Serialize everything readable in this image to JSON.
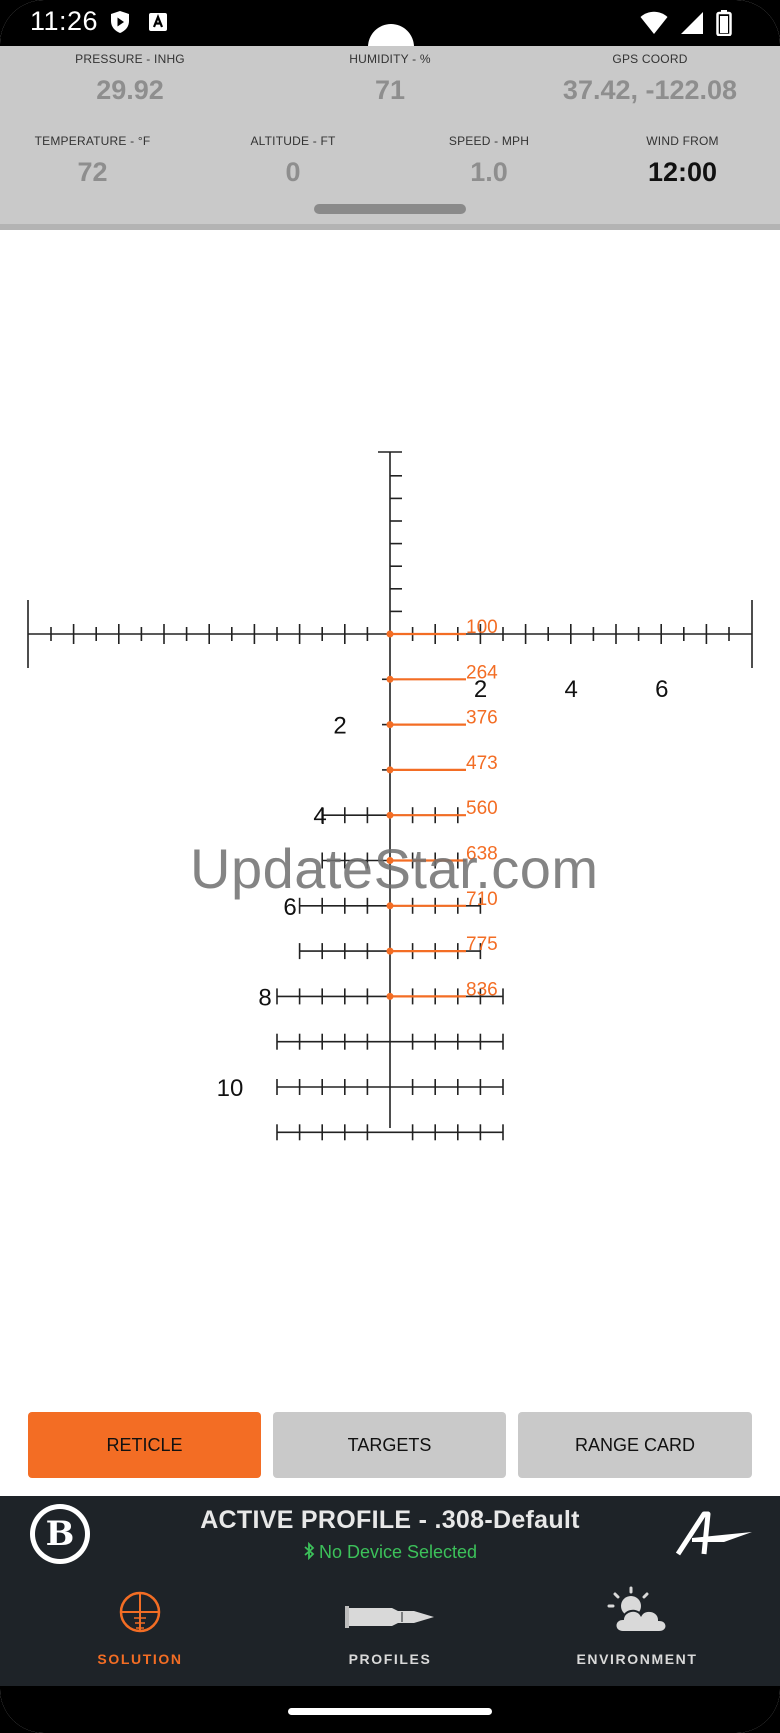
{
  "status_bar": {
    "time": "11:26"
  },
  "environment": {
    "pressure": {
      "label": "PRESSURE - INHG",
      "value": "29.92"
    },
    "humidity": {
      "label": "HUMIDITY - %",
      "value": "71"
    },
    "gps": {
      "label": "GPS COORD",
      "value": "37.42, -122.08"
    },
    "temperature": {
      "label": "TEMPERATURE - °F",
      "value": "72"
    },
    "altitude": {
      "label": "ALTITUDE - FT",
      "value": "0"
    },
    "speed": {
      "label": "SPEED - MPH",
      "value": "1.0"
    },
    "wind": {
      "label": "WIND FROM",
      "value": "12:00"
    }
  },
  "reticle": {
    "windage_labels": [
      "2",
      "4",
      "6"
    ],
    "elevation_labels": [
      "2",
      "4",
      "6",
      "8",
      "10"
    ],
    "range_marks": [
      {
        "range": "100",
        "mil": 0
      },
      {
        "range": "264",
        "mil": 1
      },
      {
        "range": "376",
        "mil": 2
      },
      {
        "range": "473",
        "mil": 3
      },
      {
        "range": "560",
        "mil": 4
      },
      {
        "range": "638",
        "mil": 5
      },
      {
        "range": "710",
        "mil": 6
      },
      {
        "range": "775",
        "mil": 7
      },
      {
        "range": "836",
        "mil": 8
      }
    ],
    "accent_color": "#f36d24"
  },
  "watermark": "UpdateStar.com",
  "tabs": {
    "reticle": "RETICLE",
    "targets": "TARGETS",
    "range_card": "RANGE CARD",
    "active": "reticle"
  },
  "profile": {
    "title": "ACTIVE PROFILE - .308-Default",
    "device_status": "No Device Selected",
    "status_color": "#3cc15a"
  },
  "nav": {
    "solution": "SOLUTION",
    "profiles": "PROFILES",
    "environment": "ENVIRONMENT",
    "active": "solution"
  },
  "icons": {
    "brand": "bushnell-b-logo",
    "partner": "applied-ballistics-logo",
    "solution": "crosshair-icon",
    "profiles": "cartridge-icon",
    "environment": "weather-icon"
  }
}
